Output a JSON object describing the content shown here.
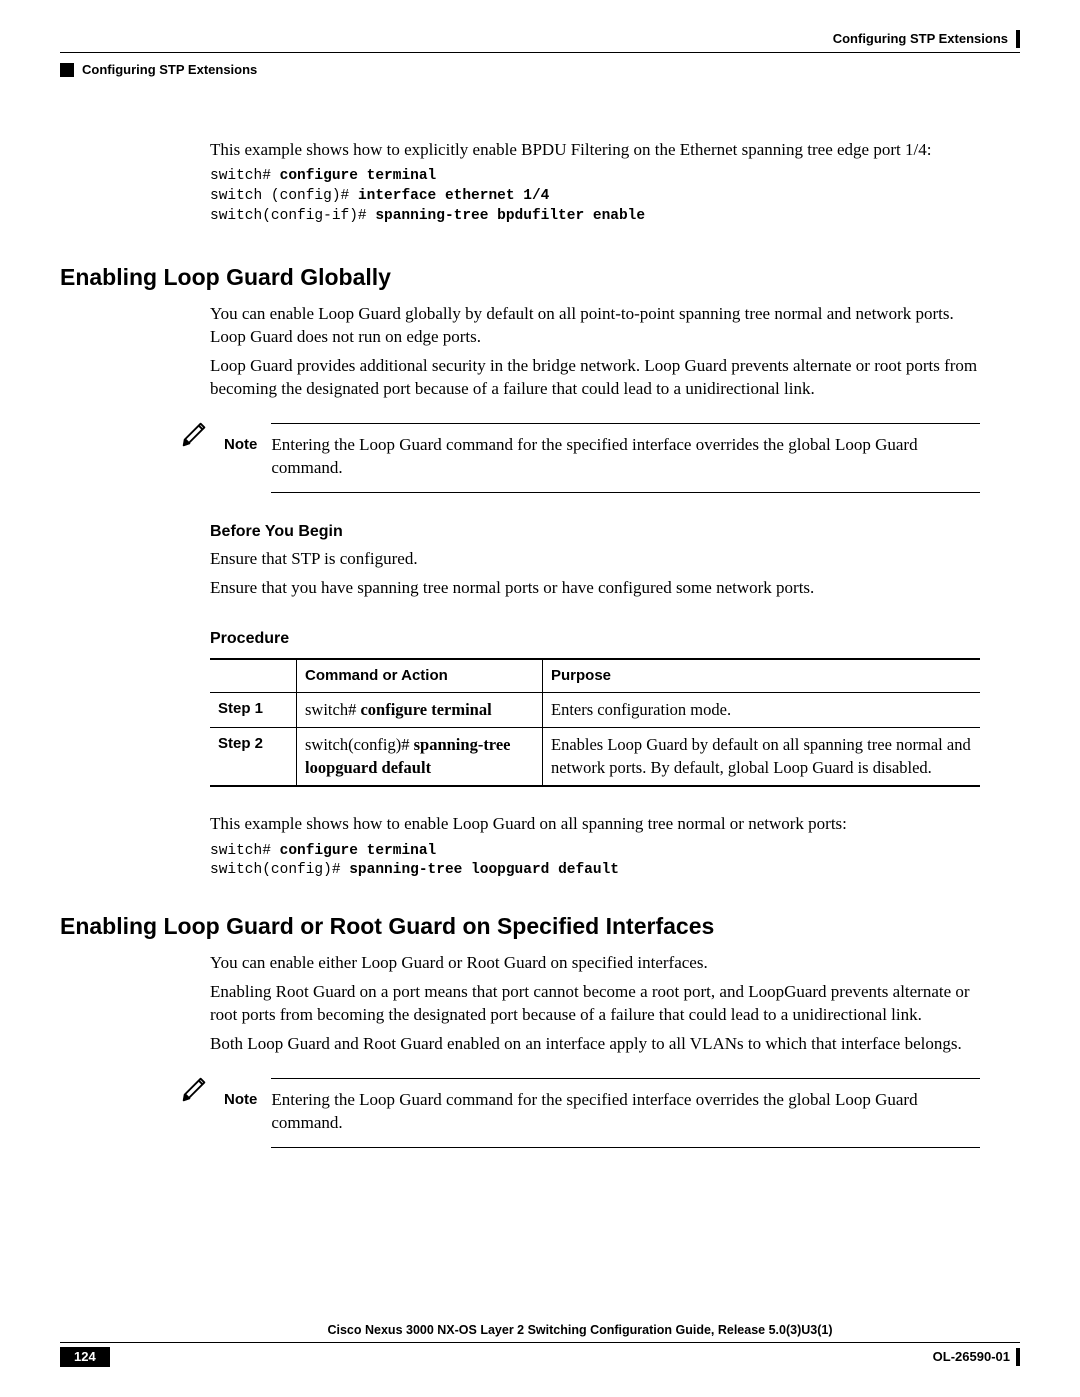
{
  "header": {
    "right_title": "Configuring STP Extensions",
    "left_sub": "Configuring STP Extensions"
  },
  "intro": {
    "text": "This example shows how to explicitly enable BPDU Filtering on the Ethernet spanning tree edge port 1/4:",
    "code_p1": "switch# ",
    "code_b1": "configure terminal",
    "code_p2": "switch (config)# ",
    "code_b2": "interface ethernet 1/4",
    "code_p3": "switch(config-if)# ",
    "code_b3": "spanning-tree bpdufilter enable"
  },
  "sec1": {
    "title": "Enabling Loop Guard Globally",
    "p1": "You can enable Loop Guard globally by default on all point-to-point spanning tree normal and network ports. Loop Guard does not run on edge ports.",
    "p2": "Loop Guard provides additional security in the bridge network. Loop Guard prevents alternate or root ports from becoming the designated port because of a failure that could lead to a unidirectional link.",
    "note_label": "Note",
    "note_text": "Entering the Loop Guard command for the specified interface overrides the global Loop Guard command.",
    "byb_title": "Before You Begin",
    "byb_p1": "Ensure that STP is configured.",
    "byb_p2": "Ensure that you have spanning tree normal ports or have configured some network ports.",
    "proc_title": "Procedure",
    "th_ca": "Command or Action",
    "th_purpose": "Purpose",
    "step1": "Step 1",
    "step1_prompt": "switch# ",
    "step1_cmd": "configure terminal",
    "step1_purpose": "Enters configuration mode.",
    "step2": "Step 2",
    "step2_prompt": "switch(config)# ",
    "step2_cmd": "spanning-tree loopguard default",
    "step2_purpose": "Enables Loop Guard by default on all spanning tree normal and network ports. By default, global Loop Guard is disabled.",
    "post_text": "This example shows how to enable Loop Guard on all spanning tree normal or network ports:",
    "code_p1": "switch# ",
    "code_b1": "configure terminal",
    "code_p2": "switch(config)# ",
    "code_b2": "spanning-tree loopguard default"
  },
  "sec2": {
    "title": "Enabling Loop Guard or Root Guard on Specified Interfaces",
    "p1": "You can enable either Loop Guard or Root Guard on specified interfaces.",
    "p2": "Enabling Root Guard on a port means that port cannot become a root port, and LoopGuard prevents alternate or root ports from becoming the designated port because of a failure that could lead to a unidirectional link.",
    "p3": "Both Loop Guard and Root Guard enabled on an interface apply to all VLANs to which that interface belongs.",
    "note_label": "Note",
    "note_text": "Entering the Loop Guard command for the specified interface overrides the global Loop Guard command."
  },
  "footer": {
    "book": "Cisco Nexus 3000 NX-OS Layer 2 Switching Configuration Guide, Release 5.0(3)U3(1)",
    "page": "124",
    "ol": "OL-26590-01"
  }
}
